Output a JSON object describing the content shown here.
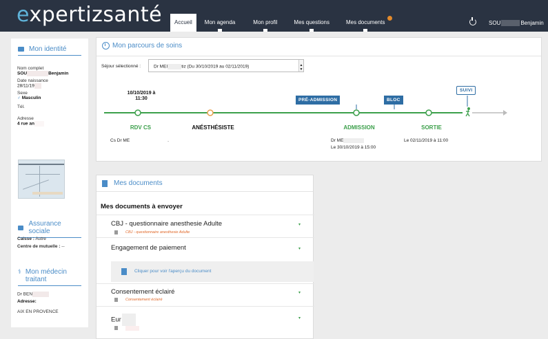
{
  "app": {
    "logo_prefix": "e",
    "logo_rest": "xpertizsanté"
  },
  "nav": {
    "items": [
      {
        "label": "Accueil"
      },
      {
        "label": "Mon agenda"
      },
      {
        "label": "Mon profil"
      },
      {
        "label": "Mes questions"
      },
      {
        "label": "Mes documents"
      }
    ],
    "user_prefix": "SOU",
    "user_name": "Benjamin"
  },
  "identity": {
    "title": "Mon identité",
    "nom_label": "Nom complet",
    "nom_prefix": "SOU",
    "nom_value": "Benjamin",
    "dob_label": "Date naissance",
    "dob_value": "28/11/19",
    "sexe_label": "Sexe",
    "sexe_value": "Masculin",
    "tel_label": "Tél.",
    "adresse_label": "Adresse",
    "adresse_value": "4 rue an"
  },
  "assurance": {
    "title": "Assurance sociale",
    "caisse_label": "Caisse :",
    "caisse_value": "Autre",
    "mutuelle_label": "Centre de mutuelle :",
    "mutuelle_value": "--"
  },
  "medecin": {
    "title_line1": "Mon médecin",
    "title_line2": "traitant",
    "name": "Dr BEN",
    "adresse_label": "Adresse:",
    "city": "AIX EN PROVENCE"
  },
  "parcours": {
    "title": "Mon parcours de soins",
    "sejour_label": "Séjour sélectionné :",
    "sejour_prefix": "Dr MEI",
    "sejour_value": "tiz (Du 30/10/2019 au 02/11/2019)",
    "steps": [
      {
        "label": "RDV CS",
        "date_line1": "10/10/2019 à",
        "date_line2": "11:30",
        "detail": "Cs Dr ME",
        "detail2": "."
      },
      {
        "label": "ANÉSTHÉSISTE"
      },
      {
        "label": "ADMISSION",
        "detail": "Dr ME",
        "detail2": "Le 30/10/2019 à 15:00"
      },
      {
        "label": "SORTIE",
        "detail": "Le 02/11/2019 à 11:00"
      }
    ],
    "tags": {
      "preadmission": "PRÉ-ADMISSION",
      "bloc": "BLOC",
      "suivi": "SUIVI"
    },
    "colors": {
      "done": "#3b9f4a",
      "pending": "#e8a04c",
      "tag": "#2e6da4"
    }
  },
  "documents": {
    "title": "Mes documents",
    "heading": "Mes documents à envoyer",
    "items": [
      {
        "name": "CBJ - questionnaire anesthesie Adulte",
        "sub": "CBJ - questionnaire anesthesie Adulte"
      },
      {
        "name": "Engagement de paiement"
      },
      {
        "name": "Consentement éclairé",
        "sub": "Consentement éclairé"
      },
      {
        "name": "Eur"
      }
    ],
    "preview_text": "Cliquer pour voir l'aperçu du document"
  }
}
